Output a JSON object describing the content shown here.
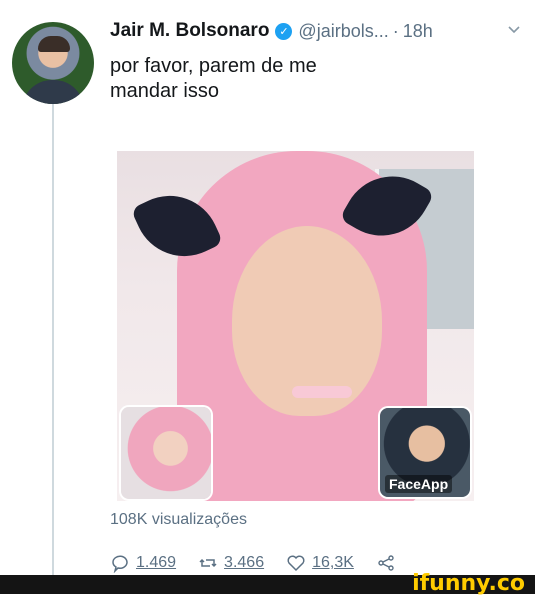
{
  "tweet": {
    "author_name": "Jair M. Bolsonaro",
    "handle": "@jairbols...",
    "dot": "·",
    "time": "18h",
    "text_lines": [
      "por favor, parem de me",
      "mandar isso"
    ],
    "views": "108K visualizações"
  },
  "media": {
    "watermark": "FaceApp",
    "thumbs": [
      "pink-wig-girl-thumbnail",
      "bolsonaro-thumbnail"
    ]
  },
  "actions": {
    "reply_count": "1.469",
    "retweet_count": "3.466",
    "like_count": "16,3K"
  },
  "footer": {
    "brand": "ifunny.co"
  },
  "colors": {
    "verified": "#1da1f2",
    "muted_text": "#5b7083",
    "brand_yellow": "#ffcc00",
    "footer_bg": "#141414"
  },
  "icons": [
    "verified-icon",
    "chevron-down-icon",
    "reply-icon",
    "retweet-icon",
    "like-icon",
    "share-icon"
  ]
}
